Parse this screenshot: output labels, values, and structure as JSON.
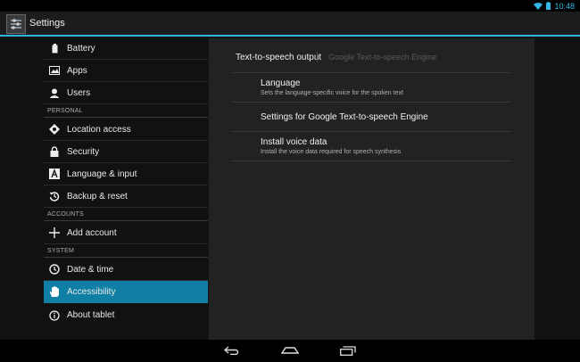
{
  "status_bar": {
    "time": "10:48",
    "icons": [
      "wifi-icon",
      "battery-icon"
    ]
  },
  "action_bar": {
    "title": "Settings",
    "icon": "settings-app-icon"
  },
  "sidebar": {
    "items": [
      {
        "label": "Battery",
        "icon": "battery-icon"
      },
      {
        "label": "Apps",
        "icon": "apps-icon"
      },
      {
        "label": "Users",
        "icon": "users-icon"
      },
      {
        "label": "Location access",
        "icon": "location-icon"
      },
      {
        "label": "Security",
        "icon": "lock-icon"
      },
      {
        "label": "Language & input",
        "icon": "language-icon"
      },
      {
        "label": "Backup & reset",
        "icon": "backup-icon"
      },
      {
        "label": "Add account",
        "icon": "add-icon"
      },
      {
        "label": "Date & time",
        "icon": "clock-icon"
      },
      {
        "label": "Accessibility",
        "icon": "hand-icon"
      },
      {
        "label": "About tablet",
        "icon": "info-icon"
      }
    ],
    "headers": {
      "personal": "PERSONAL",
      "accounts": "ACCOUNTS",
      "system": "SYSTEM"
    },
    "selected": "Accessibility"
  },
  "detail": {
    "title": "Text-to-speech output",
    "engine": "Google Text-to-speech Engine",
    "prefs": [
      {
        "title": "Language",
        "summary": "Sets the language-specific voice for the spoken text"
      },
      {
        "title": "Settings for Google Text-to-speech Engine",
        "summary": ""
      },
      {
        "title": "Install voice data",
        "summary": "Install the voice data required for speech synthesis"
      }
    ]
  },
  "nav_bar": {
    "buttons": [
      "back-icon",
      "home-icon",
      "recents-icon"
    ]
  },
  "colors": {
    "accent": "#33b5e5",
    "selected_bg": "#0f7fa5"
  }
}
